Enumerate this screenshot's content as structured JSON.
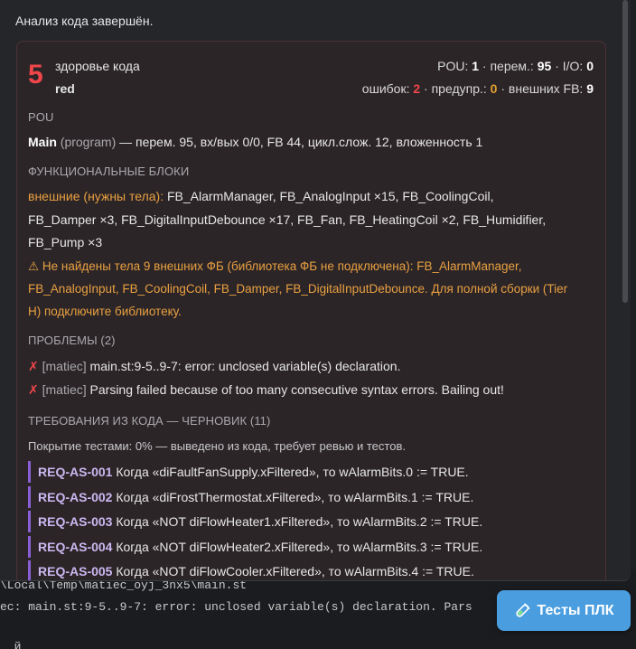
{
  "terminal": {
    "line1": "\\Local\\Temp\\matiec_oyj_3nx5\\main.st",
    "line2": "ec: main.st:9-5..9-7: error: unclosed variable(s) declaration. Pars",
    "line3": "  й"
  },
  "status_message": "Анализ кода завершён.",
  "summary": {
    "score": "5",
    "health_label": "здоровье кода",
    "grade": "red",
    "pou_label": "POU:",
    "pou_value": "1",
    "vars_label": "· перем.:",
    "vars_value": "95",
    "io_label": "· I/O:",
    "io_value": "0",
    "errors_label": "ошибок:",
    "errors_value": "2",
    "warnings_label": "· предупр.:",
    "warnings_value": "0",
    "external_fb_label": "· внешних FB:",
    "external_fb_value": "9"
  },
  "pou_section": {
    "title": "POU",
    "name": "Main",
    "kind": "(program)",
    "details": "— перем. 95, вх/вых 0/0, FB 44, цикл.слож. 12, вложенность 1"
  },
  "fb_section": {
    "title": "ФУНКЦИОНАЛЬНЫЕ БЛОКИ",
    "external_label": "внешние (нужны тела):",
    "external_line1": "FB_AlarmManager, FB_AnalogInput ×15, FB_CoolingCoil,",
    "external_line2": "FB_Damper ×3, FB_DigitalInputDebounce ×17, FB_Fan, FB_HeatingCoil ×2, FB_Humidifier,",
    "external_line3": "FB_Pump ×3",
    "warning_line1": "⚠ Не найдены тела 9 внешних ФБ (библиотека ФБ не подключена): FB_AlarmManager,",
    "warning_line2": "FB_AnalogInput, FB_CoolingCoil, FB_Damper, FB_DigitalInputDebounce. Для полной сборки (Tier",
    "warning_line3": "H) подключите библиотеку."
  },
  "problems_section": {
    "title": "ПРОБЛЕМЫ (2)",
    "items": [
      {
        "mark": "✗",
        "source": "[matiec]",
        "text": "main.st:9-5..9-7: error: unclosed variable(s) declaration."
      },
      {
        "mark": "✗",
        "source": "[matiec]",
        "text": "Parsing failed because of too many consecutive syntax errors. Bailing out!"
      }
    ]
  },
  "requirements_section": {
    "title": "ТРЕБОВАНИЯ ИЗ КОДА — ЧЕРНОВИК (11)",
    "coverage_note": "Покрытие тестами: 0% — выведено из кода, требует ревью и тестов.",
    "items": [
      {
        "id": "REQ-AS-001",
        "text": "Когда «diFaultFanSupply.xFiltered», то wAlarmBits.0 := TRUE."
      },
      {
        "id": "REQ-AS-002",
        "text": "Когда «diFrostThermostat.xFiltered», то wAlarmBits.1 := TRUE."
      },
      {
        "id": "REQ-AS-003",
        "text": "Когда «NOT diFlowHeater1.xFiltered», то wAlarmBits.2 := TRUE."
      },
      {
        "id": "REQ-AS-004",
        "text": "Когда «NOT diFlowHeater2.xFiltered», то wAlarmBits.3 := TRUE."
      },
      {
        "id": "REQ-AS-005",
        "text": "Когда «NOT diFlowCooler.xFiltered», то wAlarmBits.4 := TRUE."
      }
    ]
  },
  "tests_button": {
    "label": "Тесты ПЛК",
    "icon": "test-tube-icon"
  },
  "colors": {
    "error": "#f0464a",
    "warning": "#e8a040",
    "accent": "#4a9ee0",
    "requirement_bar": "#8a5fd6"
  }
}
